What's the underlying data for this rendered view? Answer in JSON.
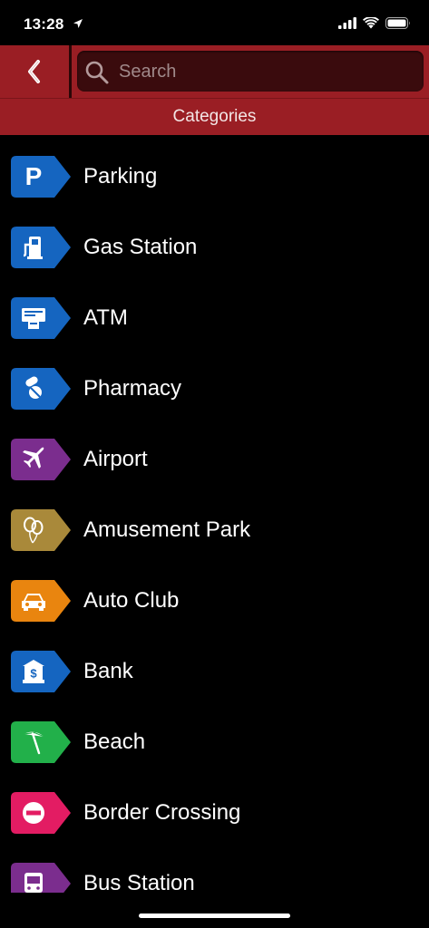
{
  "status": {
    "time": "13:28"
  },
  "header": {
    "back_icon": "chevron-left-icon",
    "search_placeholder": "Search",
    "search_value": ""
  },
  "subheader": {
    "title": "Categories"
  },
  "categories": [
    {
      "label": "Parking",
      "icon": "parking-icon",
      "color": "#1565c0"
    },
    {
      "label": "Gas Station",
      "icon": "gas-pump-icon",
      "color": "#1565c0"
    },
    {
      "label": "ATM",
      "icon": "atm-icon",
      "color": "#1565c0"
    },
    {
      "label": "Pharmacy",
      "icon": "pill-icon",
      "color": "#1565c0"
    },
    {
      "label": "Airport",
      "icon": "airplane-icon",
      "color": "#7b2d8e"
    },
    {
      "label": "Amusement Park",
      "icon": "balloons-icon",
      "color": "#a9893a"
    },
    {
      "label": "Auto Club",
      "icon": "car-icon",
      "color": "#e9850f"
    },
    {
      "label": "Bank",
      "icon": "bank-icon",
      "color": "#1565c0"
    },
    {
      "label": "Beach",
      "icon": "beach-umbrella-icon",
      "color": "#22b04a"
    },
    {
      "label": "Border Crossing",
      "icon": "no-entry-icon",
      "color": "#e31c63"
    },
    {
      "label": "Bus Station",
      "icon": "bus-icon",
      "color": "#7b2d8e"
    }
  ]
}
